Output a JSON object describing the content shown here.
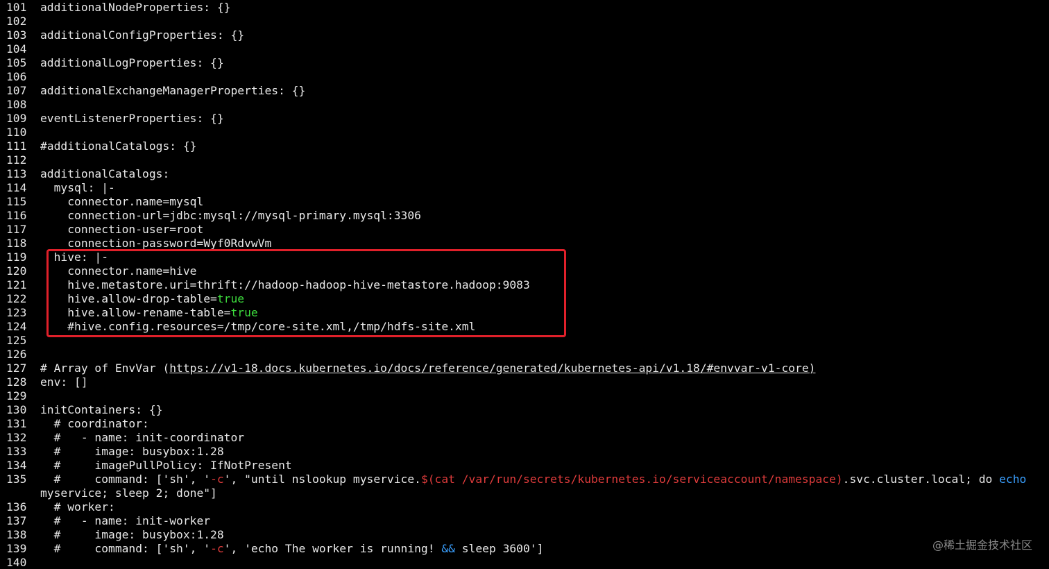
{
  "editor": {
    "lines": [
      {
        "n": "101",
        "segs": [
          {
            "t": "additionalNodeProperties: {}"
          }
        ]
      },
      {
        "n": "102",
        "segs": []
      },
      {
        "n": "103",
        "segs": [
          {
            "t": "additionalConfigProperties: {}"
          }
        ]
      },
      {
        "n": "104",
        "segs": []
      },
      {
        "n": "105",
        "segs": [
          {
            "t": "additionalLogProperties: {}"
          }
        ]
      },
      {
        "n": "106",
        "segs": []
      },
      {
        "n": "107",
        "segs": [
          {
            "t": "additionalExchangeManagerProperties: {}"
          }
        ]
      },
      {
        "n": "108",
        "segs": []
      },
      {
        "n": "109",
        "segs": [
          {
            "t": "eventListenerProperties: {}"
          }
        ]
      },
      {
        "n": "110",
        "segs": []
      },
      {
        "n": "111",
        "segs": [
          {
            "t": "#additionalCatalogs: {}"
          }
        ]
      },
      {
        "n": "112",
        "segs": []
      },
      {
        "n": "113",
        "segs": [
          {
            "t": "additionalCatalogs:"
          }
        ]
      },
      {
        "n": "114",
        "segs": [
          {
            "t": "  mysql: |-"
          }
        ]
      },
      {
        "n": "115",
        "segs": [
          {
            "t": "    connector.name=mysql"
          }
        ]
      },
      {
        "n": "116",
        "segs": [
          {
            "t": "    connection-url=jdbc:mysql://mysql-primary.mysql:3306"
          }
        ]
      },
      {
        "n": "117",
        "segs": [
          {
            "t": "    connection-user=root"
          }
        ]
      },
      {
        "n": "118",
        "segs": [
          {
            "t": "    connection-password=Wyf0RdvwVm"
          }
        ]
      },
      {
        "n": "119",
        "segs": [
          {
            "t": "  hive: |-"
          }
        ]
      },
      {
        "n": "120",
        "segs": [
          {
            "t": "    connector.name=hive"
          }
        ]
      },
      {
        "n": "121",
        "segs": [
          {
            "t": "    hive.metastore.uri=thrift://hadoop-hadoop-hive-metastore.hadoop:9083"
          }
        ]
      },
      {
        "n": "122",
        "segs": [
          {
            "t": "    hive.allow-drop-table="
          },
          {
            "t": "true",
            "c": "t-green"
          }
        ]
      },
      {
        "n": "123",
        "segs": [
          {
            "t": "    hive.allow-rename-table="
          },
          {
            "t": "true",
            "c": "t-green"
          }
        ]
      },
      {
        "n": "124",
        "segs": [
          {
            "t": "    #hive.config.resources=/tmp/core-site.xml,/tmp/hdfs-site.xml"
          }
        ]
      },
      {
        "n": "125",
        "segs": []
      },
      {
        "n": "126",
        "segs": []
      },
      {
        "n": "127",
        "segs": [
          {
            "t": "# Array of EnvVar ("
          },
          {
            "t": "https://v1-18.docs.kubernetes.io/docs/reference/generated/kubernetes-api/v1.18/#envvar-v1-core)",
            "c": "t-link"
          }
        ]
      },
      {
        "n": "128",
        "segs": [
          {
            "t": "env: []"
          }
        ]
      },
      {
        "n": "129",
        "segs": []
      },
      {
        "n": "130",
        "segs": [
          {
            "t": "initContainers: {}"
          }
        ]
      },
      {
        "n": "131",
        "segs": [
          {
            "t": "  # coordinator:"
          }
        ]
      },
      {
        "n": "132",
        "segs": [
          {
            "t": "  #   - name: init-coordinator"
          }
        ]
      },
      {
        "n": "133",
        "segs": [
          {
            "t": "  #     image: busybox:1.28"
          }
        ]
      },
      {
        "n": "134",
        "segs": [
          {
            "t": "  #     imagePullPolicy: IfNotPresent"
          }
        ]
      },
      {
        "n": "135",
        "segs": [
          {
            "t": "  #     command: ['sh', '"
          },
          {
            "t": "-c",
            "c": "t-red"
          },
          {
            "t": "', \"until nslookup myservice."
          },
          {
            "t": "$(cat /var/run/secrets/kubernetes.io/serviceaccount/namespace)",
            "c": "t-red"
          },
          {
            "t": ".svc.cluster.local; do "
          },
          {
            "t": "echo",
            "c": "t-blue"
          }
        ]
      },
      {
        "n": "",
        "segs": [
          {
            "t": "myservice; sleep 2; done\"]"
          }
        ]
      },
      {
        "n": "136",
        "segs": [
          {
            "t": "  # worker:"
          }
        ]
      },
      {
        "n": "137",
        "segs": [
          {
            "t": "  #   - name: init-worker"
          }
        ]
      },
      {
        "n": "138",
        "segs": [
          {
            "t": "  #     image: busybox:1.28"
          }
        ]
      },
      {
        "n": "139",
        "segs": [
          {
            "t": "  #     command: ['sh', '"
          },
          {
            "t": "-c",
            "c": "t-red"
          },
          {
            "t": "', 'echo The worker is running! "
          },
          {
            "t": "&&",
            "c": "t-blue"
          },
          {
            "t": " sleep 3600']"
          }
        ]
      },
      {
        "n": "140",
        "segs": []
      }
    ]
  },
  "watermark": "@稀土掘金技术社区",
  "colors": {
    "background": "#000000",
    "text": "#e8e8e8",
    "keyword_green": "#3ddc3d",
    "string_red": "#e03c3c",
    "builtin_blue": "#3aa0ff",
    "highlight_border": "#e0202a"
  }
}
